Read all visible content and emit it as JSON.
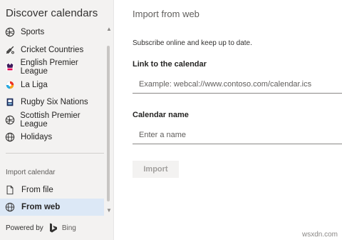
{
  "sidebar": {
    "title": "Discover calendars",
    "calendars": [
      {
        "label": "Sports",
        "icon": "globe-icon"
      },
      {
        "label": "Cricket Countries",
        "icon": "cricket-bat-icon"
      },
      {
        "label": "English Premier League",
        "icon": "premier-league-logo-icon"
      },
      {
        "label": "La Liga",
        "icon": "la-liga-logo-icon"
      },
      {
        "label": "Rugby Six Nations",
        "icon": "six-nations-logo-icon"
      },
      {
        "label": "Scottish Premier League",
        "icon": "globe-icon"
      },
      {
        "label": "Holidays",
        "icon": "globe-icon"
      }
    ],
    "import_section_label": "Import calendar",
    "import_items": [
      {
        "label": "From file",
        "icon": "file-icon"
      },
      {
        "label": "From web",
        "icon": "globe-icon",
        "selected": true
      }
    ],
    "powered_by": "Powered by",
    "bing": "Bing"
  },
  "main": {
    "title": "Import from web",
    "subtitle": "Subscribe online and keep up to date.",
    "link_label": "Link to the calendar",
    "link_placeholder": "Example: webcal://www.contoso.com/calendar.ics",
    "name_label": "Calendar name",
    "name_placeholder": "Enter a name",
    "import_button": "Import"
  },
  "watermark": "wsxdn.com",
  "colors": {
    "sidebar_bg": "#f3f2f1",
    "selected_bg": "#dce8f6",
    "bing_teal": "#008373"
  }
}
